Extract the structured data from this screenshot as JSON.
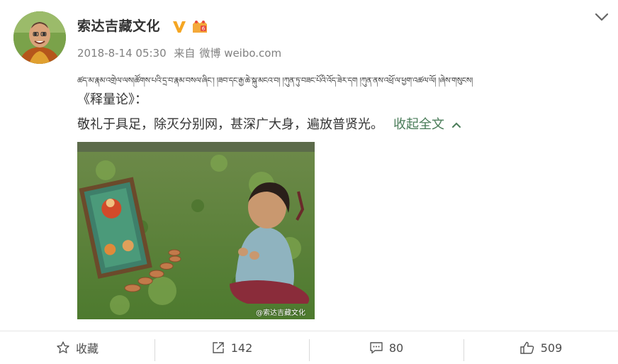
{
  "post": {
    "author": "索达吉藏文化",
    "timestamp": "2018-8-14 05:30",
    "source_prefix": "来自",
    "source": "微博 weibo.com",
    "tibetan_line": "ཚད་མ་རྣམ་འགྲེལ་ལས།ཚོགས་པའི་དྲ་བ་རྣམ་བསལ་ཞིང་། །ཟབ་དང་རྒྱ་ཆེ་སྐུ་མངའ་བ། །ཀུན་ཏུ་བཟང་པོའི་འོད་ཟེར་དག །ཀུན་ནས་འཕྲོ་ལ་ཕྱག་འཚལ་ལོ། །ཞེས་གསུངས།",
    "title_line": "《释量论》：",
    "body_line": "敬礼于具足，除灭分别网，甚深广大身，遍放普贤光。",
    "collapse_label": "收起全文",
    "watermark": "@索达吉藏文化"
  },
  "actions": {
    "favorite_label": "收藏",
    "repost_count": "142",
    "comment_count": "80",
    "like_count": "509"
  },
  "colors": {
    "accent": "#4a7c59",
    "verified": "#f5a623",
    "meta": "#808080"
  },
  "icons": [
    "chevron-down-icon",
    "verified-icon",
    "level-badge-icon",
    "star-icon",
    "repost-icon",
    "comment-icon",
    "like-icon"
  ]
}
